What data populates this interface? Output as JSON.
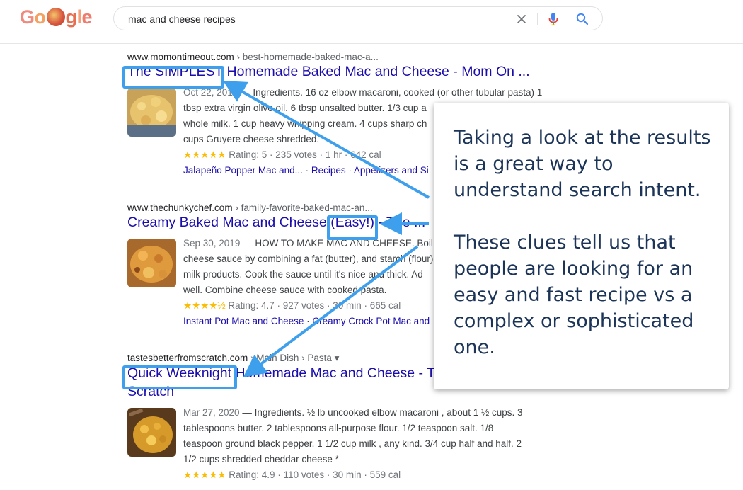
{
  "header": {
    "logo": {
      "letters": [
        "G",
        "o",
        "g",
        "l",
        "e"
      ]
    },
    "search": {
      "query": "mac and cheese recipes",
      "clear_icon": "close-icon",
      "mic_icon": "microphone-icon",
      "search_icon": "search-icon"
    }
  },
  "results": [
    {
      "site": "www.momontimeout.com",
      "path": " › best-homemade-baked-mac-a...",
      "title": "The SIMPLEST Homemade Baked Mac and Cheese - Mom On ...",
      "highlight": "The SIMPLEST",
      "lines": [
        {
          "date": "Oct 22, 2018",
          "text": " — Ingredients. 16 oz elbow macaroni, cooked (or other tubular pasta) 1"
        },
        {
          "text": "tbsp extra virgin olive oil. 6 tbsp unsalted butter. 1/3 cup a"
        },
        {
          "text": "whole milk. 1 cup heavy whipping cream. 4 cups sharp ch"
        },
        {
          "text": "cups Gruyere cheese shredded."
        }
      ],
      "stars": "★★★★★",
      "rating": " Rating: 5 · 235 votes · 1 hr · 642 cal",
      "sitelinks": [
        "Jalapeño Popper Mac and...",
        "Recipes",
        "Appetizers and Si"
      ]
    },
    {
      "site": "www.thechunkychef.com",
      "path": " › family-favorite-baked-mac-an...",
      "title": "Creamy Baked Mac and Cheese (Easy!) - The ...",
      "highlight": "(Easy!)",
      "lines": [
        {
          "date": "Sep 30, 2019",
          "text": " — HOW TO MAKE MAC AND CHEESE. Boil t"
        },
        {
          "text": "cheese sauce by combining a fat (butter), and starch (flour) w"
        },
        {
          "text": "milk products. Cook the sauce until it's nice and thick. Ad"
        },
        {
          "text": "well. Combine cheese sauce with cooked pasta."
        }
      ],
      "stars": "★★★★½",
      "rating": " Rating: 4.7 · 927 votes · 30 min · 665 cal",
      "sitelinks": [
        "Instant Pot Mac and Cheese",
        "Creamy Crock Pot Mac and"
      ]
    },
    {
      "site": "tastesbetterfromscratch.com",
      "path": " › Main Dish › Pasta",
      "title_line1": "Quick Weeknight Homemade Mac and Cheese - T",
      "title_line2": "Scratch",
      "highlight": "Quick Weeknight",
      "lines": [
        {
          "date": "Mar 27, 2020",
          "text": " — Ingredients. ½ lb uncooked elbow macaroni , about 1 ½ cups. 3"
        },
        {
          "text": "tablespoons butter. 2 tablespoons all-purpose flour. 1/2 teaspoon salt. 1/8"
        },
        {
          "text": "teaspoon ground black pepper. 1 1/2 cup milk , any kind. 3/4 cup half and half. 2"
        },
        {
          "text": "1/2 cups shredded cheddar cheese *"
        }
      ],
      "stars": "★★★★★",
      "rating": " Rating: 4.9 · 110 votes · 30 min · 559 cal"
    }
  ],
  "callout": {
    "paragraph1": "Taking a look at the results is a great way to understand search intent.",
    "paragraph2": "These clues tell us that people are looking for an easy and fast recipe vs a complex or sophisticated one."
  },
  "colors": {
    "link": "#1a0dab",
    "highlight": "#3ea0ec",
    "callout_text": "#1c3458",
    "star": "#fbbc04"
  }
}
